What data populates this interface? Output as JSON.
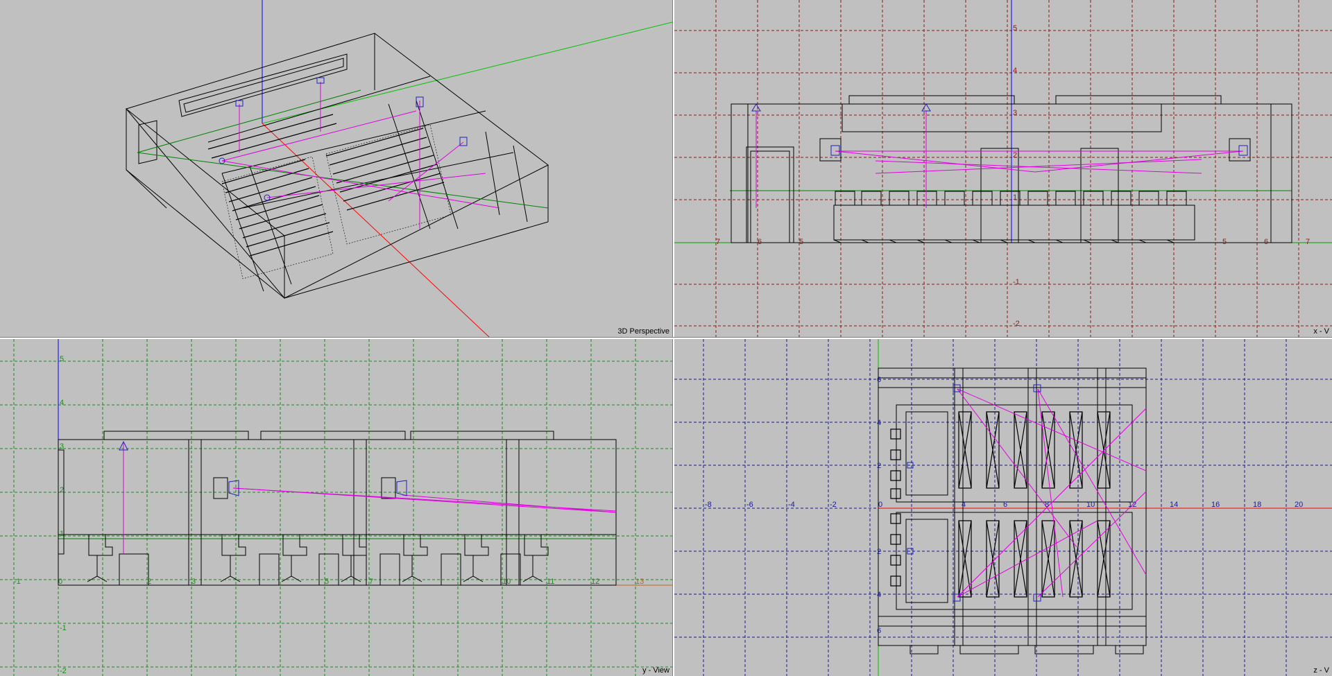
{
  "viewports": {
    "perspective": {
      "label": "3D Perspective"
    },
    "xview": {
      "label": "x - V"
    },
    "yview": {
      "label": "y - View"
    },
    "zview": {
      "label": "z - V"
    }
  },
  "colors": {
    "background": "#c0c0c0",
    "wire": "#000000",
    "light": "#e000e0",
    "x_grid": "#8b1a1a",
    "y_grid": "#1a8b1a",
    "z_grid": "#1a1a8b",
    "axis_x": "#ff0000",
    "axis_y": "#00c000",
    "axis_z": "#0000ff"
  },
  "xview_ticks": {
    "horizontal": [
      "7",
      "6",
      "5",
      "5",
      "6",
      "7"
    ],
    "vertical": [
      "5",
      "4",
      "3",
      "2",
      "1",
      "-1",
      "-2"
    ]
  },
  "yview_ticks": {
    "horizontal": [
      "-1",
      "0",
      "2",
      "3",
      "5",
      "7",
      "10",
      "11",
      "12",
      "13"
    ],
    "vertical": [
      "5",
      "4",
      "3",
      "2",
      "1",
      "-1",
      "-2"
    ]
  },
  "zview_ticks": {
    "horizontal": [
      "-8",
      "-6",
      "-4",
      "-2",
      "0",
      "4",
      "6",
      "8",
      "10",
      "12",
      "14",
      "16",
      "18",
      "20"
    ],
    "vertical": [
      "6",
      "4",
      "2",
      "2",
      "4",
      "6"
    ]
  }
}
